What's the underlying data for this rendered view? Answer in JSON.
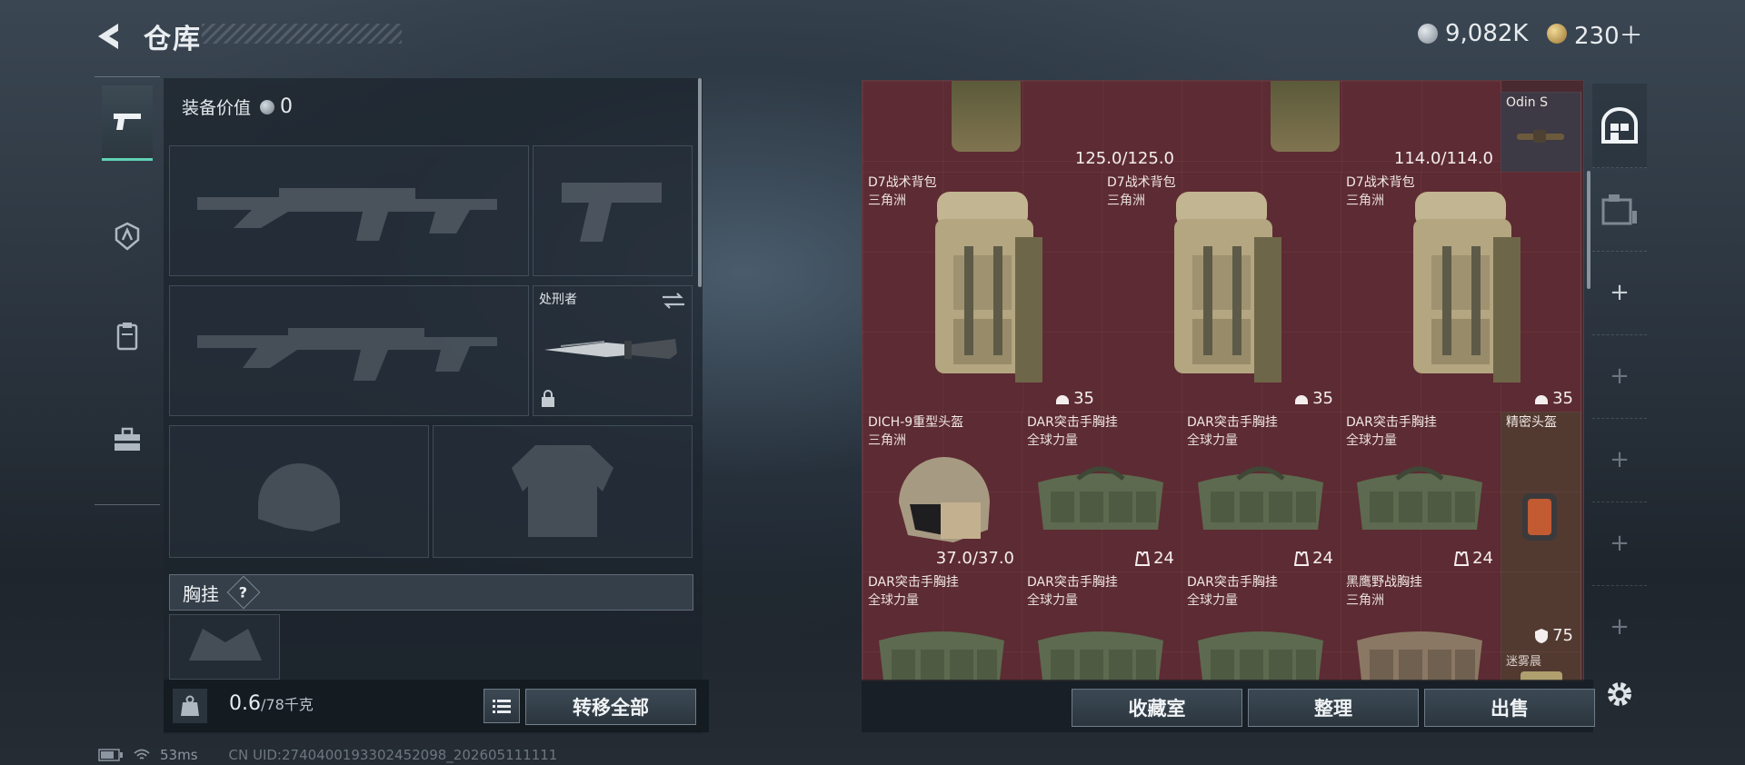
{
  "header": {
    "title": "仓库",
    "currency": [
      {
        "value": "9,082K",
        "icon": "silver-coin-icon",
        "color": "#9fa8b0"
      },
      {
        "value": "230＋",
        "icon": "gold-coin-icon",
        "color": "#c9a45a"
      }
    ]
  },
  "left_nav": [
    {
      "icon": "pistol-icon",
      "selected": true
    },
    {
      "icon": "operator-badge-icon",
      "selected": false
    },
    {
      "icon": "armor-vest-icon",
      "selected": false
    },
    {
      "icon": "toolbox-icon",
      "selected": false
    }
  ],
  "equipment": {
    "value_label": "装备价值",
    "value": "0",
    "melee_name": "处刑者",
    "chest_section": "胸挂",
    "chest_help": "?"
  },
  "left_bottom": {
    "weight": "0.6",
    "capacity": "/78千克",
    "transfer_all": "转移全部"
  },
  "grid": {
    "top_row": [
      {
        "qty": "125.0/125.0"
      },
      {
        "qty": "114.0/114.0"
      },
      {
        "name": "Odin S"
      }
    ],
    "items": [
      {
        "name": "D7战术背包",
        "sub": "三角洲",
        "qty": "35",
        "qty_icon": "helmet-icon"
      },
      {
        "name": "D7战术背包",
        "sub": "三角洲",
        "qty": "35",
        "qty_icon": "helmet-icon"
      },
      {
        "name": "D7战术背包",
        "sub": "三角洲",
        "qty": "35",
        "qty_icon": "helmet-icon"
      },
      {
        "name": "DICH-9重型头盔",
        "sub": "三角洲",
        "qty": "37.0/37.0"
      },
      {
        "name": "DAR突击手胸挂",
        "sub": "全球力量",
        "qty": "24",
        "qty_icon": "vest-icon"
      },
      {
        "name": "DAR突击手胸挂",
        "sub": "全球力量",
        "qty": "24",
        "qty_icon": "vest-icon"
      },
      {
        "name": "DAR突击手胸挂",
        "sub": "全球力量",
        "qty": "24",
        "qty_icon": "vest-icon"
      },
      {
        "name": "精密头盔",
        "sub": ""
      },
      {
        "name": "DAR突击手胸挂",
        "sub": "全球力量"
      },
      {
        "name": "DAR突击手胸挂",
        "sub": "全球力量"
      },
      {
        "name": "DAR突击手胸挂",
        "sub": "全球力量"
      },
      {
        "name": "黑鹰野战胸挂",
        "sub": "三角洲"
      },
      {
        "name": "迷雾晨",
        "qty": "75",
        "qty_icon": "shield-icon"
      }
    ]
  },
  "right_buttons": [
    "收藏室",
    "整理",
    "出售"
  ],
  "right_nav": {
    "plus": "+"
  },
  "status": {
    "ping": "53ms",
    "uid": "CN UID:2740400193302452098_202605111111"
  }
}
